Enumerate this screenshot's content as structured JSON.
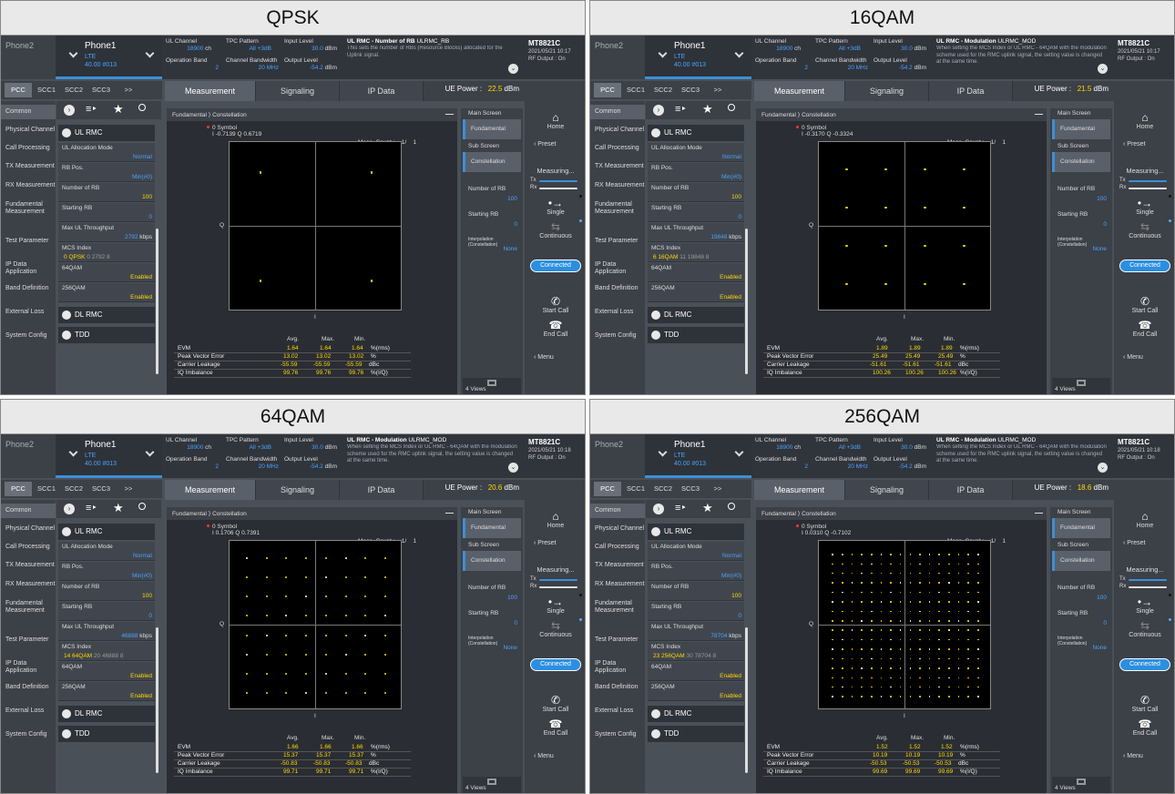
{
  "panels": [
    {
      "label": "QPSK",
      "coord": "I -0.7139 Q 0.6719",
      "ue_power": "22.5",
      "throughput": "2792",
      "mcs_value": "0",
      "mcs_mod": "QPSK",
      "mcs_itbs": "0",
      "mcs_tbs": "2792",
      "mcs_n": "8",
      "help_title": "UL RMC - Number of RB",
      "help_code": "ULRMC_RB",
      "help_body": "This sets the number of RBs (Resource Blocks) allocated for the Uplink signal.",
      "datetime": "2021/05/21 10:17",
      "evm": [
        "1.64",
        "1.64",
        "1.64"
      ],
      "pve": [
        "13.02",
        "13.02",
        "13.02"
      ],
      "cl": [
        "-55.59",
        "-55.59",
        "-55.59"
      ],
      "iq": [
        "99.76",
        "99.76",
        "99.76"
      ],
      "grid": 2,
      "spread": 0.32
    },
    {
      "label": "16QAM",
      "coord": "I -0.3170 Q -0.3324",
      "ue_power": "21.5",
      "throughput": "19848",
      "mcs_value": "6",
      "mcs_mod": "16QAM",
      "mcs_itbs": "11",
      "mcs_tbs": "19848",
      "mcs_n": "8",
      "help_title": "UL RMC - Modulation",
      "help_code": "ULRMC_MOD",
      "help_body": "When setting the MCS Index or UL RMC - 64QAM with the modulation scheme used for the RMC uplink signal, the setting value is changed at the same time.",
      "datetime": "2021/05/21 10:17",
      "evm": [
        "1.89",
        "1.89",
        "1.89"
      ],
      "pve": [
        "25.49",
        "25.49",
        "25.49"
      ],
      "cl": [
        "-51.61",
        "-51.61",
        "-51.61"
      ],
      "iq": [
        "100.26",
        "100.26",
        "100.26"
      ],
      "grid": 4,
      "spread": 0.34
    },
    {
      "label": "64QAM",
      "coord": "I 0.1706 Q 0.7391",
      "ue_power": "20.6",
      "throughput": "46888",
      "mcs_value": "14",
      "mcs_mod": "64QAM",
      "mcs_itbs": "20",
      "mcs_tbs": "46888",
      "mcs_n": "8",
      "help_title": "UL RMC - Modulation",
      "help_code": "ULRMC_MOD",
      "help_body": "When setting the MCS Index or UL RMC - 64QAM with the modulation scheme used for the RMC uplink signal, the setting value is changed at the same time.",
      "datetime": "2021/05/21 10:18",
      "evm": [
        "1.66",
        "1.66",
        "1.66"
      ],
      "pve": [
        "15.37",
        "15.37",
        "15.37"
      ],
      "cl": [
        "-50.83",
        "-50.83",
        "-50.83"
      ],
      "iq": [
        "99.71",
        "99.71",
        "99.71"
      ],
      "grid": 8,
      "spread": 0.4
    },
    {
      "label": "256QAM",
      "coord": "I 0.0310 Q -0.7102",
      "ue_power": "18.6",
      "throughput": "78704",
      "mcs_value": "23",
      "mcs_mod": "256QAM",
      "mcs_itbs": "30",
      "mcs_tbs": "78704",
      "mcs_n": "8",
      "help_title": "UL RMC - Modulation",
      "help_code": "ULRMC_MOD",
      "help_body": "When setting the MCS Index or UL RMC - 64QAM with the modulation scheme used for the RMC uplink signal, the setting value is changed at the same time.",
      "datetime": "2021/05/21 10:18",
      "evm": [
        "1.52",
        "1.52",
        "1.52"
      ],
      "pve": [
        "10.19",
        "10.19",
        "10.19"
      ],
      "cl": [
        "-50.53",
        "-50.53",
        "-50.53"
      ],
      "iq": [
        "99.69",
        "99.69",
        "99.69"
      ],
      "grid": 16,
      "spread": 0.42
    }
  ],
  "common": {
    "phone2": "Phone2",
    "phone1": "Phone1",
    "rat": "LTE",
    "freq": "40.00 #013",
    "ul_channel_label": "UL Channel",
    "ul_channel_value": "18900",
    "ul_channel_unit": "ch",
    "tpc_label": "TPC Pattern",
    "tpc_value": "All +3dB",
    "input_level_label": "Input Level",
    "input_level_value": "30.0",
    "input_level_unit": "dBm",
    "op_band_label": "Operation Band",
    "op_band_value": "2",
    "ch_bw_label": "Channel Bandwidth",
    "ch_bw_value": "20 MHz",
    "output_level_label": "Output Level",
    "output_level_value": "-54.2",
    "output_level_unit": "dBm",
    "brand": "MT8821C",
    "rf_output": "RF Output : On",
    "cc_tabs": [
      "PCC",
      "SCC1",
      "SCC2",
      "SCC3",
      ">>"
    ],
    "main_tabs": [
      "Measurement",
      "Signaling",
      "IP Data"
    ],
    "ue_power_label": "UE Power :",
    "ue_power_unit": "dBm",
    "categories": [
      "Common",
      "Physical Channel",
      "Call Processing",
      "TX Measurement",
      "RX Measurement",
      "Fundamental Measurement",
      "Test Parameter",
      "IP Data Application",
      "Band Definition",
      "External Loss",
      "System Config"
    ],
    "ul_rmc": "UL RMC",
    "dl_rmc": "DL RMC",
    "tdd": "TDD",
    "params": [
      {
        "k": "UL Allocation Mode",
        "v": "Normal"
      },
      {
        "k": "RB Pos.",
        "v": "Min(#0)"
      },
      {
        "k": "Number of RB",
        "v": "100"
      },
      {
        "k": "Starting RB",
        "v": "0"
      },
      {
        "k": "Max UL Throughput",
        "v": "kbps"
      },
      {
        "k": "MCS Index",
        "v": ""
      },
      {
        "k": "64QAM",
        "v": "Enabled"
      },
      {
        "k": "256QAM",
        "v": "Enabled"
      }
    ],
    "breadcrumb_a": "Fundamental",
    "breadcrumb_b": "Constellation",
    "symbol": "0 Symbol",
    "meas_count_label": "Meas. Count :",
    "meas_count": "1/",
    "meas_total": "1",
    "axis_q": "Q",
    "axis_i": "I",
    "col_avg": "Avg.",
    "col_max": "Max.",
    "col_min": "Min.",
    "row_evm": "EVM",
    "row_pve": "Peak Vector Error",
    "row_cl": "Carrier Leakage",
    "row_iq": "IQ Imbalance",
    "unit_evm": "%(rms)",
    "unit_pve": "%",
    "unit_cl": "dBc",
    "unit_iq": "%(I/Q)",
    "main_screen": "Main Screen",
    "fundamental": "Fundamental",
    "sub_screen": "Sub Screen",
    "constellation": "Constellation",
    "number_of_rb": "Number of RB",
    "number_of_rb_value": "100",
    "starting_rb": "Starting RB",
    "starting_rb_value": "0",
    "interp": "Interpolation (Constellation)",
    "interp_value": "None",
    "views": "4 Views",
    "home": "Home",
    "preset": "Preset",
    "measuring": "Measuring...",
    "tx": "Tx",
    "rx": "Rx",
    "single": "Single",
    "continuous": "Continuous",
    "connected": "Connected",
    "start_call": "Start Call",
    "end_call": "End Call",
    "menu": "Menu",
    "colors": {
      "accent": "#3d8fd6",
      "value": "#48a3ff",
      "highlight": "#ffd700",
      "point": "#ffd700"
    }
  }
}
